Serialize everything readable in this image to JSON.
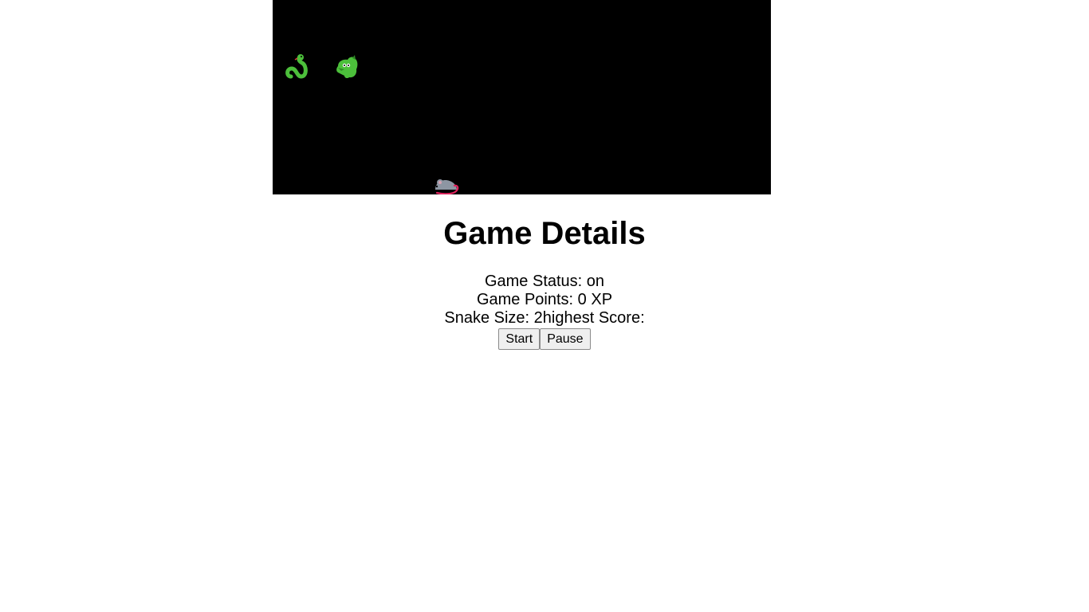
{
  "board": {
    "background": "#000000",
    "sprites": [
      {
        "name": "snake-body",
        "icon": "snake-icon"
      },
      {
        "name": "snake-head",
        "icon": "dragon-face-icon"
      },
      {
        "name": "food",
        "icon": "mouse-icon"
      }
    ]
  },
  "details": {
    "title": "Game Details",
    "status_label": "Game Status:",
    "status_value": "on",
    "points_label": "Game Points:",
    "points_value": "0",
    "points_unit": "XP",
    "size_label": "Snake Size:",
    "size_value": "2",
    "highest_label": "highest Score:",
    "highest_value": ""
  },
  "controls": {
    "start_label": "Start",
    "pause_label": "Pause"
  }
}
